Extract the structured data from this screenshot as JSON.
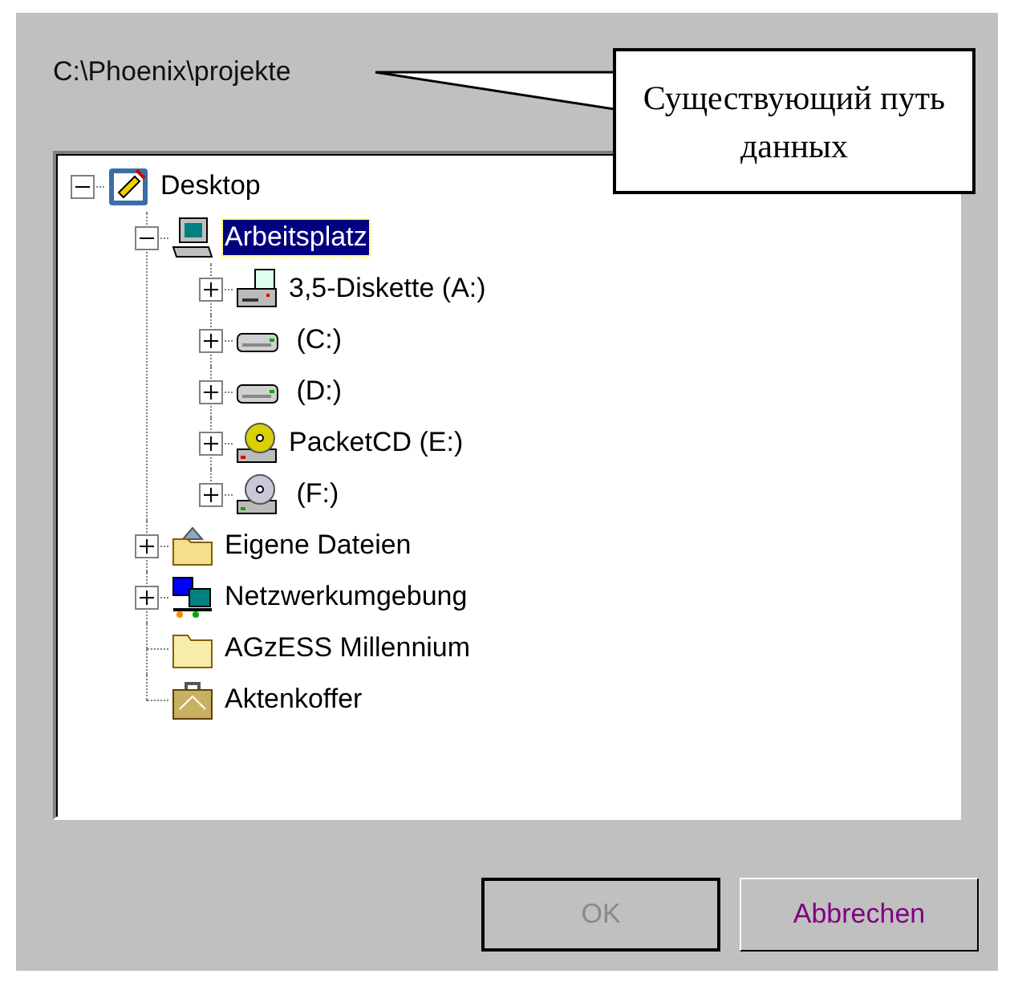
{
  "path_label": "C:\\Phoenix\\projekte",
  "callout": {
    "text": "Существующий путь данных"
  },
  "tree": [
    {
      "label": "Desktop",
      "kind": "desktop",
      "expanded": true,
      "selected": false,
      "children": [
        {
          "label": "Arbeitsplatz",
          "kind": "computer",
          "expanded": true,
          "selected": true,
          "children": [
            {
              "label": "3,5-Diskette (A:)",
              "kind": "floppy",
              "expanded": false,
              "selected": false
            },
            {
              "label": " (C:)",
              "kind": "harddisk",
              "expanded": false,
              "selected": false
            },
            {
              "label": " (D:)",
              "kind": "harddisk",
              "expanded": false,
              "selected": false
            },
            {
              "label": "PacketCD (E:)",
              "kind": "cdrom",
              "expanded": false,
              "selected": false
            },
            {
              "label": " (F:)",
              "kind": "cd",
              "expanded": false,
              "selected": false
            }
          ]
        },
        {
          "label": "Eigene Dateien",
          "kind": "documents",
          "expanded": false,
          "selected": false
        },
        {
          "label": "Netzwerkumgebung",
          "kind": "network",
          "expanded": false,
          "selected": false
        },
        {
          "label": "AGzESS Millennium",
          "kind": "folder",
          "selected": false
        },
        {
          "label": "Aktenkoffer",
          "kind": "briefcase",
          "selected": false
        }
      ]
    }
  ],
  "buttons": [
    {
      "label": "OK",
      "disabled": true,
      "default": true
    },
    {
      "label": "Abbrechen",
      "disabled": false,
      "default": false
    }
  ]
}
